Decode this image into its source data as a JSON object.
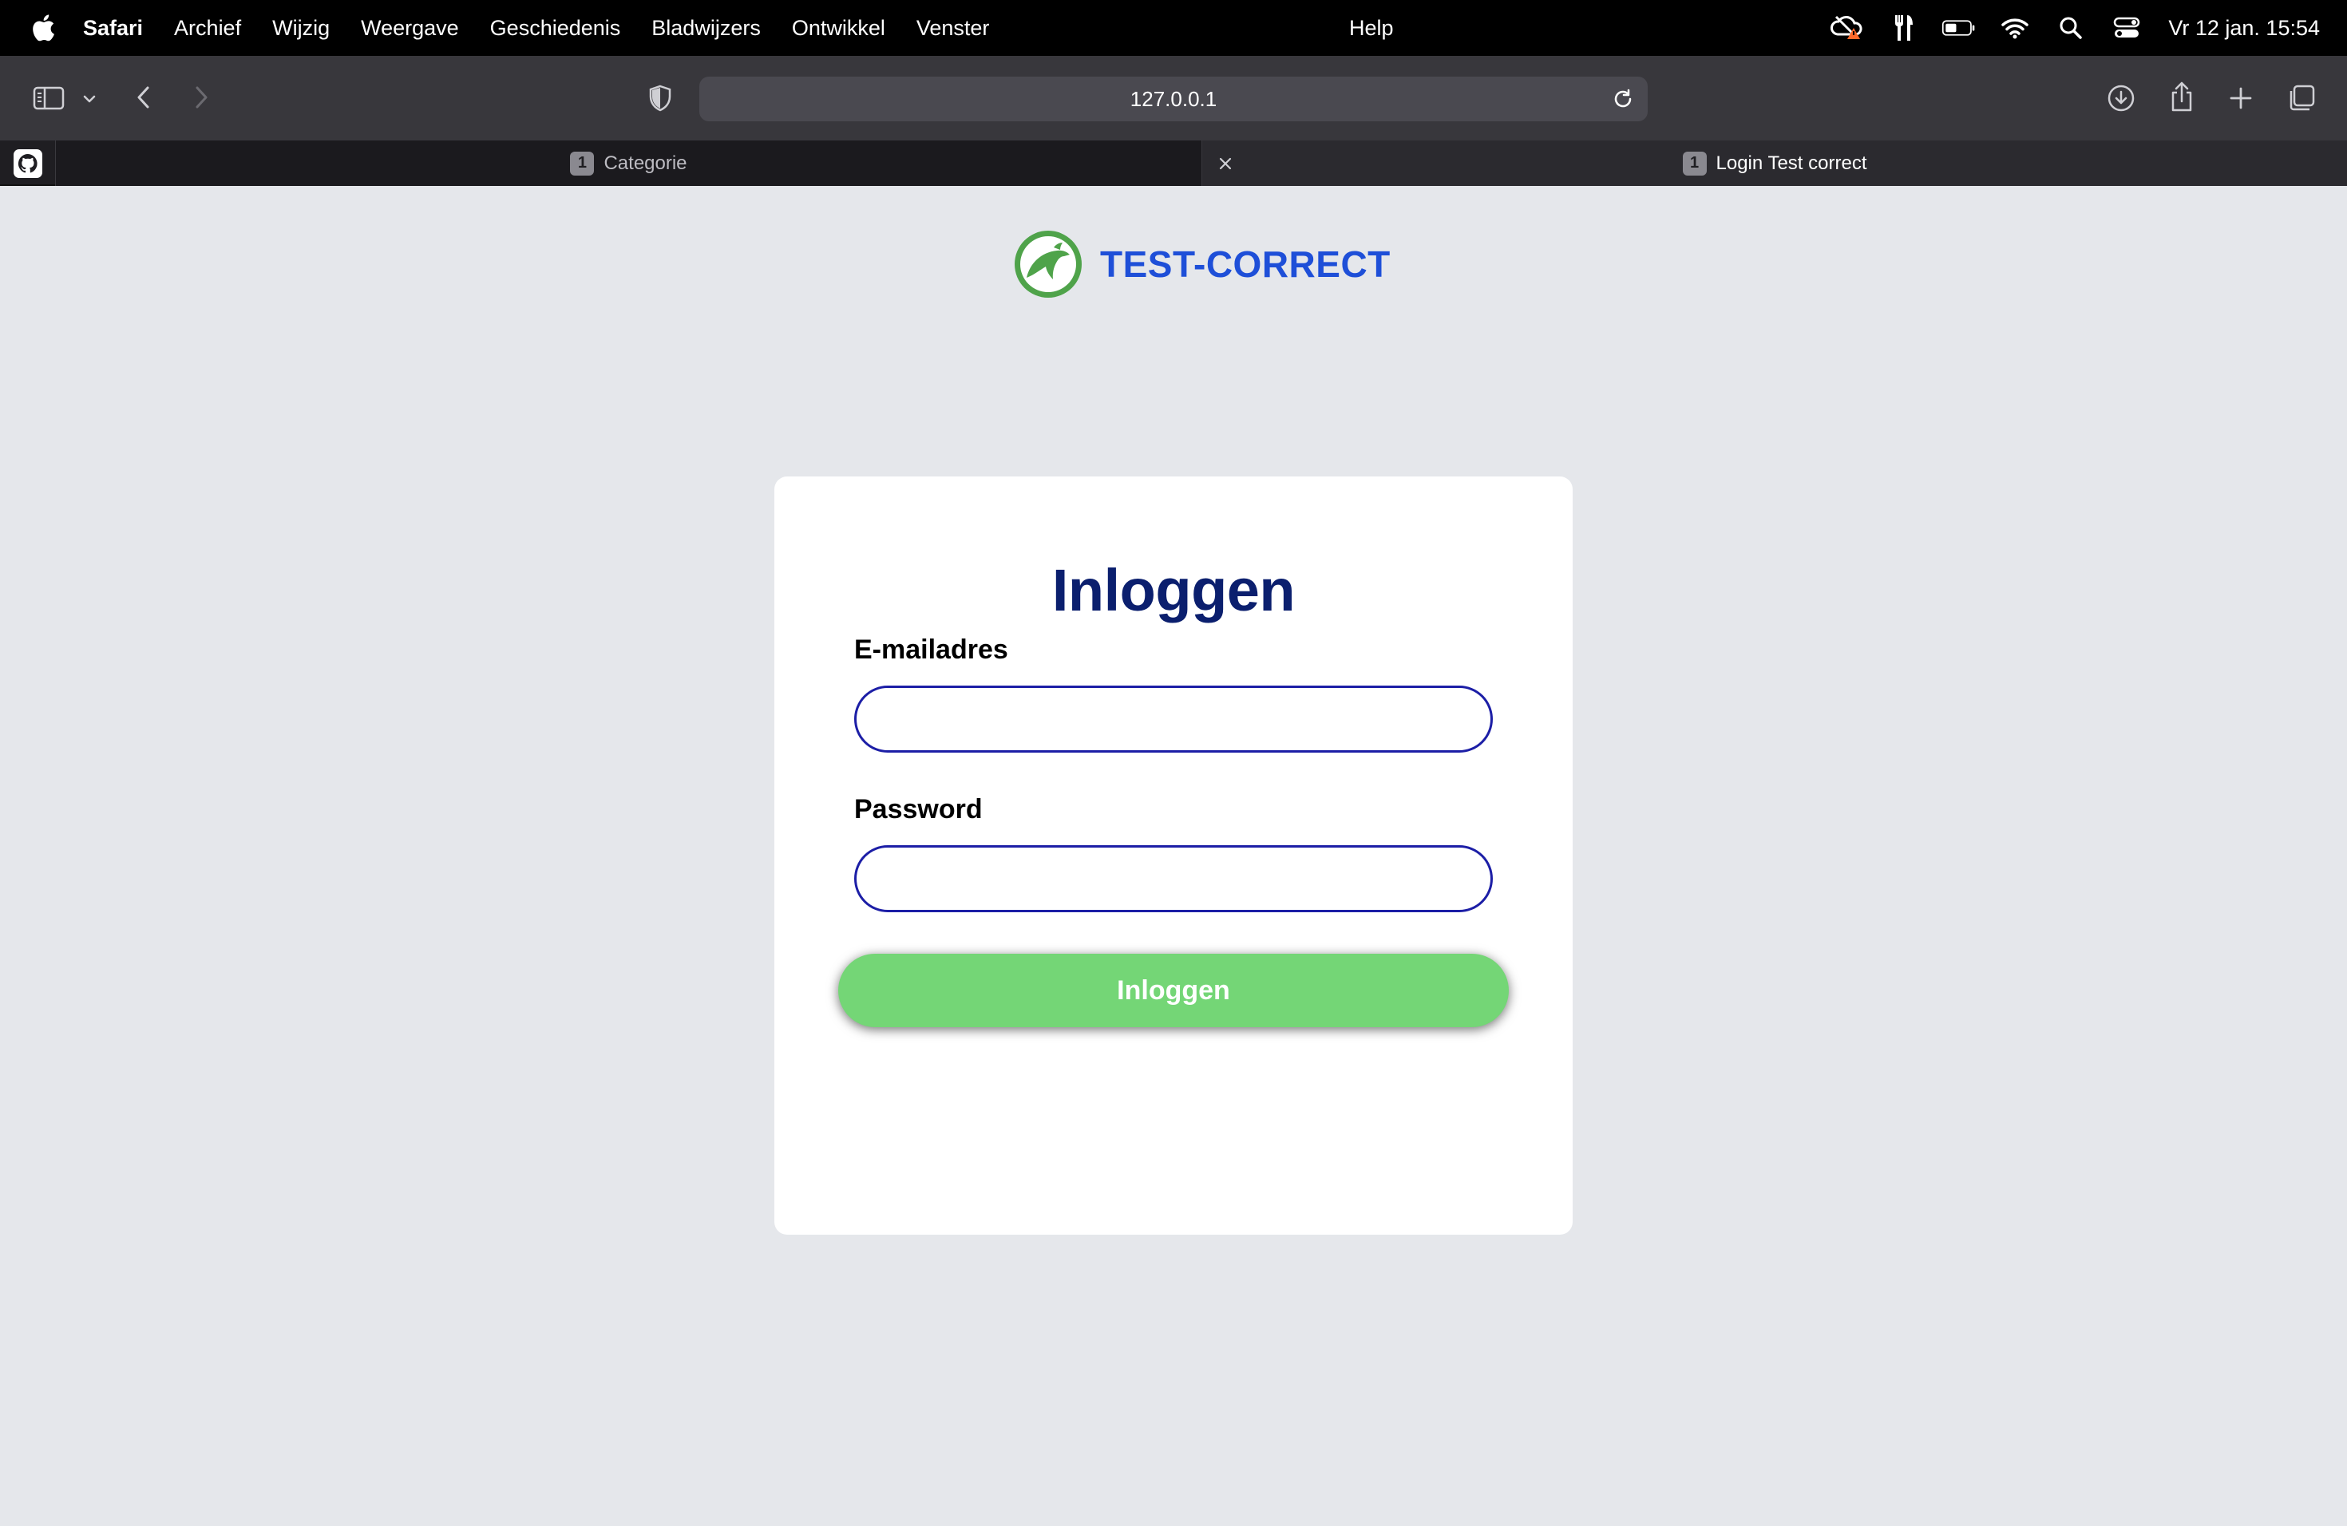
{
  "menubar": {
    "app_name": "Safari",
    "items": [
      "Archief",
      "Wijzig",
      "Weergave",
      "Geschiedenis",
      "Bladwijzers",
      "Ontwikkel",
      "Venster"
    ],
    "help": "Help",
    "clock": "Vr 12 jan.  15:54"
  },
  "toolbar": {
    "address": "127.0.0.1"
  },
  "tabs": [
    {
      "count": "1",
      "title": "Categorie"
    },
    {
      "count": "1",
      "title": "Login Test correct"
    }
  ],
  "page": {
    "logo_text": "TEST-CORRECT",
    "title": "Inloggen",
    "email_label": "E-mailadres",
    "email_value": "",
    "password_label": "Password",
    "password_value": "",
    "submit_label": "Inloggen"
  },
  "colors": {
    "accent_green": "#74d676",
    "title_navy": "#0b1f6e",
    "logo_blue": "#1e4fd8",
    "input_border": "#1c1ea6"
  }
}
